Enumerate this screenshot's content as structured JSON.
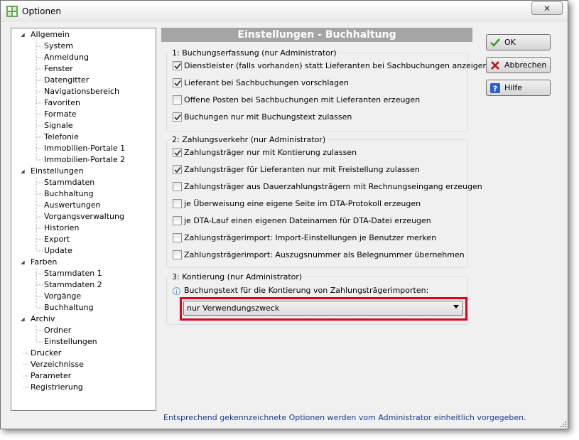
{
  "window": {
    "title": "Optionen",
    "close_glyph": "✕"
  },
  "tree": {
    "items": [
      {
        "label": "Allgemein",
        "level": 0,
        "expanded": true
      },
      {
        "label": "System",
        "level": 1
      },
      {
        "label": "Anmeldung",
        "level": 1
      },
      {
        "label": "Fenster",
        "level": 1
      },
      {
        "label": "Datengitter",
        "level": 1
      },
      {
        "label": "Navigationsbereich",
        "level": 1
      },
      {
        "label": "Favoriten",
        "level": 1
      },
      {
        "label": "Formate",
        "level": 1
      },
      {
        "label": "Signale",
        "level": 1
      },
      {
        "label": "Telefonie",
        "level": 1
      },
      {
        "label": "Immobilien-Portale 1",
        "level": 1
      },
      {
        "label": "Immobilien-Portale 2",
        "level": 1
      },
      {
        "label": "Einstellungen",
        "level": 0,
        "expanded": true
      },
      {
        "label": "Stammdaten",
        "level": 1
      },
      {
        "label": "Buchhaltung",
        "level": 1
      },
      {
        "label": "Auswertungen",
        "level": 1
      },
      {
        "label": "Vorgangsverwaltung",
        "level": 1
      },
      {
        "label": "Historien",
        "level": 1
      },
      {
        "label": "Export",
        "level": 1
      },
      {
        "label": "Update",
        "level": 1
      },
      {
        "label": "Farben",
        "level": 0,
        "expanded": true
      },
      {
        "label": "Stammdaten 1",
        "level": 1
      },
      {
        "label": "Stammdaten 2",
        "level": 1
      },
      {
        "label": "Vorgänge",
        "level": 1
      },
      {
        "label": "Buchhaltung",
        "level": 1
      },
      {
        "label": "Archiv",
        "level": 0,
        "expanded": true
      },
      {
        "label": "Ordner",
        "level": 1
      },
      {
        "label": "Einstellungen",
        "level": 1
      },
      {
        "label": "Drucker",
        "level": 0
      },
      {
        "label": "Verzeichnisse",
        "level": 0
      },
      {
        "label": "Parameter",
        "level": 0
      },
      {
        "label": "Registrierung",
        "level": 0
      }
    ]
  },
  "panel": {
    "title": "Einstellungen - Buchhaltung",
    "groups": [
      {
        "title": "1: Buchungserfassung  (nur Administrator)",
        "options": [
          {
            "label": "Dienstleister (falls vorhanden) statt Lieferanten bei Sachbuchungen anzeigen",
            "checked": true
          },
          {
            "label": "Lieferant bei Sachbuchungen vorschlagen",
            "checked": true
          },
          {
            "label": "Offene Posten bei Sachbuchungen mit Lieferanten erzeugen",
            "checked": false
          },
          {
            "label": "Buchungen nur mit Buchungstext zulassen",
            "checked": true
          }
        ]
      },
      {
        "title": "2: Zahlungsverkehr  (nur Administrator)",
        "options": [
          {
            "label": "Zahlungsträger nur mit Kontierung zulassen",
            "checked": true
          },
          {
            "label": "Zahlungsträger für Lieferanten nur mit Freistellung zulassen",
            "checked": true
          },
          {
            "label": "Zahlungsträger aus Dauerzahlungsträgern mit Rechnungseingang erzeugen",
            "checked": false
          },
          {
            "label": "je Überweisung eine eigene Seite im DTA-Protokoll erzeugen",
            "checked": false
          },
          {
            "label": "je DTA-Lauf einen eigenen Dateinamen für DTA-Datei erzeugen",
            "checked": false
          },
          {
            "label": "Zahlungsträgerimport: Import-Einstellungen je Benutzer merken",
            "checked": false
          },
          {
            "label": "Zahlungsträgerimport: Auszugsnummer als Belegnummer übernehmen",
            "checked": false
          }
        ]
      },
      {
        "title": "3: Kontierung  (nur Administrator)",
        "info_label": "Buchungstext für die Kontierung von Zahlungsträgerimporten:",
        "select_value": "nur Verwendungszweck",
        "info_glyph": "i"
      }
    ]
  },
  "buttons": {
    "ok": "OK",
    "cancel": "Abbrechen",
    "help": "Hilfe",
    "help_glyph": "?"
  },
  "footer": "Entsprechend gekennzeichnete Optionen werden vom Administrator einheitlich vorgegeben.",
  "colors": {
    "header_bg": "#a5a5a5",
    "highlight_frame": "#e0001a",
    "footer_text": "#1a3a8a",
    "ok_check": "#3a9a2a",
    "cancel_x": "#c01010",
    "help_icon": "#2d5fc9"
  }
}
